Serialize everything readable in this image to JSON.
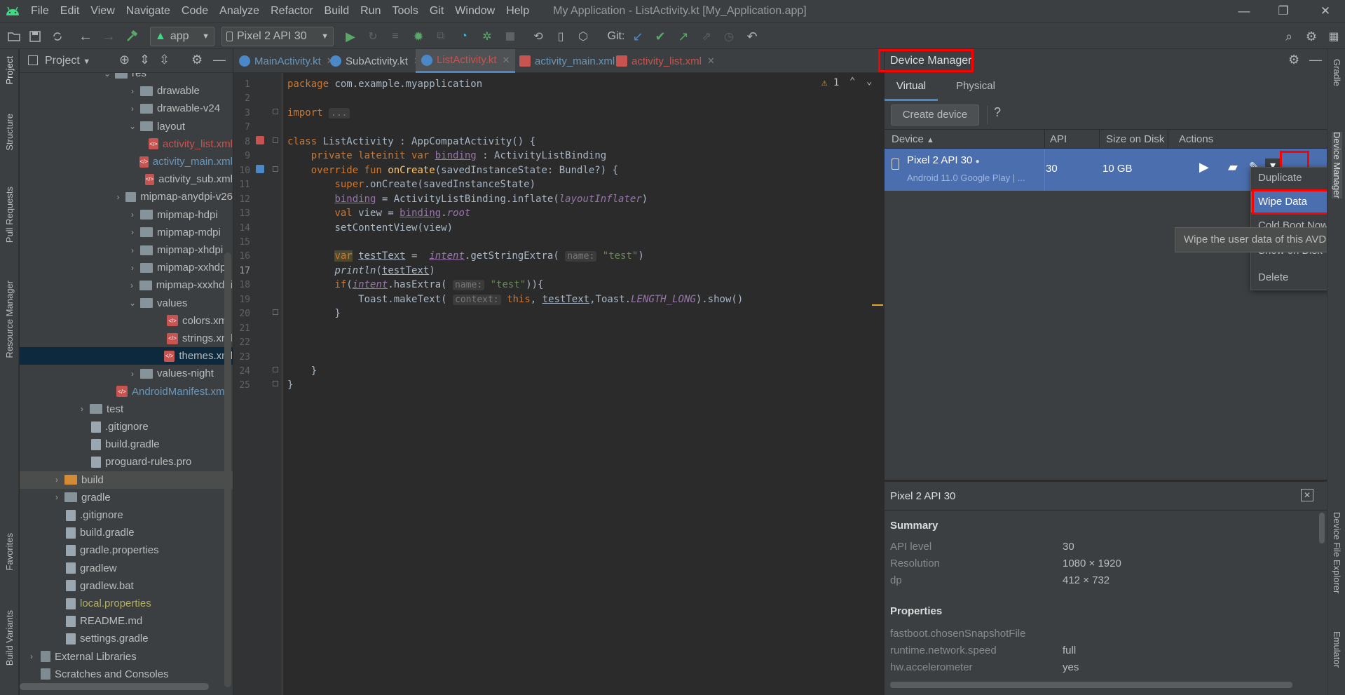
{
  "menu": [
    "File",
    "Edit",
    "View",
    "Navigate",
    "Code",
    "Analyze",
    "Refactor",
    "Build",
    "Run",
    "Tools",
    "Git",
    "Window",
    "Help"
  ],
  "window_title": "My Application - ListActivity.kt [My_Application.app]",
  "toolbar": {
    "config": "app",
    "device": "Pixel 2 API 30",
    "git_label": "Git:"
  },
  "left_strip": [
    "Project",
    "Structure",
    "Pull Requests",
    "Resource Manager",
    "Favorites",
    "Build Variants"
  ],
  "right_strip": [
    "Gradle",
    "Device Manager",
    "Device File Explorer",
    "Emulator"
  ],
  "project": {
    "title": "Project",
    "tree": [
      {
        "label": "res",
        "depth": 3,
        "kind": "folder",
        "arrow": "v"
      },
      {
        "label": "drawable",
        "depth": 4,
        "kind": "folder",
        "arrow": ">"
      },
      {
        "label": "drawable-v24",
        "depth": 4,
        "kind": "folder",
        "arrow": ">"
      },
      {
        "label": "layout",
        "depth": 4,
        "kind": "folder",
        "arrow": "v"
      },
      {
        "label": "activity_list.xml",
        "depth": 5,
        "kind": "xml",
        "color": "#c75450"
      },
      {
        "label": "activity_main.xml",
        "depth": 5,
        "kind": "xml",
        "color": "#6897bb"
      },
      {
        "label": "activity_sub.xml",
        "depth": 5,
        "kind": "xml",
        "color": "#bbbbbb"
      },
      {
        "label": "mipmap-anydpi-v26",
        "depth": 4,
        "kind": "folder",
        "arrow": ">"
      },
      {
        "label": "mipmap-hdpi",
        "depth": 4,
        "kind": "folder",
        "arrow": ">"
      },
      {
        "label": "mipmap-mdpi",
        "depth": 4,
        "kind": "folder",
        "arrow": ">"
      },
      {
        "label": "mipmap-xhdpi",
        "depth": 4,
        "kind": "folder",
        "arrow": ">"
      },
      {
        "label": "mipmap-xxhdpi",
        "depth": 4,
        "kind": "folder",
        "arrow": ">"
      },
      {
        "label": "mipmap-xxxhdpi",
        "depth": 4,
        "kind": "folder",
        "arrow": ">"
      },
      {
        "label": "values",
        "depth": 4,
        "kind": "folder",
        "arrow": "v"
      },
      {
        "label": "colors.xml",
        "depth": 5,
        "kind": "xml",
        "color": "#bbbbbb"
      },
      {
        "label": "strings.xml",
        "depth": 5,
        "kind": "xml",
        "color": "#bbbbbb"
      },
      {
        "label": "themes.xml",
        "depth": 5,
        "kind": "xml",
        "color": "#bbbbbb",
        "selected": true
      },
      {
        "label": "values-night",
        "depth": 4,
        "kind": "folder",
        "arrow": ">"
      },
      {
        "label": "AndroidManifest.xml",
        "depth": 3,
        "kind": "xml",
        "color": "#6897bb"
      },
      {
        "label": "test",
        "depth": 2,
        "kind": "folder",
        "arrow": ">"
      },
      {
        "label": ".gitignore",
        "depth": 2,
        "kind": "file",
        "color": "#bbbbbb"
      },
      {
        "label": "build.gradle",
        "depth": 2,
        "kind": "file",
        "color": "#bbbbbb"
      },
      {
        "label": "proguard-rules.pro",
        "depth": 2,
        "kind": "file",
        "color": "#bbbbbb"
      },
      {
        "label": "build",
        "depth": 1,
        "kind": "folder-orange",
        "arrow": ">",
        "hover": true
      },
      {
        "label": "gradle",
        "depth": 1,
        "kind": "folder",
        "arrow": ">"
      },
      {
        "label": ".gitignore",
        "depth": 1,
        "kind": "file",
        "color": "#bbbbbb"
      },
      {
        "label": "build.gradle",
        "depth": 1,
        "kind": "file",
        "color": "#bbbbbb"
      },
      {
        "label": "gradle.properties",
        "depth": 1,
        "kind": "file",
        "color": "#bbbbbb"
      },
      {
        "label": "gradlew",
        "depth": 1,
        "kind": "file",
        "color": "#bbbbbb"
      },
      {
        "label": "gradlew.bat",
        "depth": 1,
        "kind": "file",
        "color": "#bbbbbb"
      },
      {
        "label": "local.properties",
        "depth": 1,
        "kind": "file",
        "color": "#b3ae60"
      },
      {
        "label": "README.md",
        "depth": 1,
        "kind": "file",
        "color": "#bbbbbb"
      },
      {
        "label": "settings.gradle",
        "depth": 1,
        "kind": "file",
        "color": "#bbbbbb"
      },
      {
        "label": "External Libraries",
        "depth": 0,
        "kind": "lib",
        "arrow": ">"
      },
      {
        "label": "Scratches and Consoles",
        "depth": 0,
        "kind": "lib"
      }
    ]
  },
  "tabs": [
    {
      "label": "MainActivity.kt",
      "color": "#6897bb"
    },
    {
      "label": "SubActivity.kt",
      "color": "#bbbbbb"
    },
    {
      "label": "ListActivity.kt",
      "color": "#c75450",
      "active": true
    },
    {
      "label": "activity_main.xml",
      "color": "#6897bb"
    },
    {
      "label": "activity_list.xml",
      "color": "#c75450"
    }
  ],
  "editor": {
    "warnings": "1",
    "lines": [
      {
        "n": "1",
        "html": "<span class='kw'>package </span><span class='txt'>com.example.myapplication</span>"
      },
      {
        "n": "2",
        "html": ""
      },
      {
        "n": "3",
        "html": "<span class='kw'>import </span><span class='hint'>...</span>"
      },
      {
        "n": "7",
        "html": ""
      },
      {
        "n": "8",
        "html": "<span class='kw'>class </span><span class='txt'>ListActivity : AppCompatActivity() {</span>"
      },
      {
        "n": "9",
        "html": "    <span class='kw'>private lateinit var </span><span class='pr'>binding</span><span class='txt'> : ActivityListBinding</span>"
      },
      {
        "n": "10",
        "html": "    <span class='kw'>override fun </span><span class='fn'>onCreate</span><span class='txt'>(savedInstanceState: Bundle?) {</span>"
      },
      {
        "n": "11",
        "html": "        <span class='kw'>super</span><span class='txt'>.onCreate(savedInstanceState)</span>"
      },
      {
        "n": "12",
        "html": "        <span class='pr'>binding</span><span class='txt'> = ActivityListBinding.inflate(</span><span class='it'>layoutInflater</span><span class='txt'>)</span>"
      },
      {
        "n": "13",
        "html": "        <span class='kw'>val </span><span class='txt'>view = </span><span class='pr'>binding</span><span class='txt'>.</span><span class='it'>root</span>"
      },
      {
        "n": "14",
        "html": "        <span class='txt'>setContentView(view)</span>"
      },
      {
        "n": "15",
        "html": ""
      },
      {
        "n": "16",
        "html": "        <span class='kw' style='background:#4e4a30'>var</span><span class='txt'> </span><span class='txt ul'>testText</span><span class='txt'> =  </span><span class='it ul'>intent</span><span class='txt'>.getStringExtra( </span><span class='hint'>name:</span><span class='str'> \"test\"</span><span class='txt'>)</span>"
      },
      {
        "n": "17",
        "html": "        <span class='it' style='color:#a9b7c6'>println</span><span class='txt'>(</span><span class='txt ul'>testText</span><span class='txt'>)</span>"
      },
      {
        "n": "18",
        "html": "        <span class='kw'>if</span><span class='txt'>(</span><span class='it ul'>intent</span><span class='txt'>.hasExtra( </span><span class='hint'>name:</span><span class='str'> \"test\"</span><span class='txt'>)){</span>"
      },
      {
        "n": "19",
        "html": "            <span class='txt'>Toast.makeText( </span><span class='hint'>context:</span><span class='kw'> this</span><span class='txt'>, </span><span class='txt ul'>testText</span><span class='txt'>,Toast.</span><span class='it'>LENGTH_LONG</span><span class='txt'>).show()</span>"
      },
      {
        "n": "20",
        "html": "        <span class='txt'>}</span>"
      },
      {
        "n": "21",
        "html": ""
      },
      {
        "n": "22",
        "html": ""
      },
      {
        "n": "23",
        "html": ""
      },
      {
        "n": "24",
        "html": "    <span class='txt'>}</span>"
      },
      {
        "n": "25",
        "html": "<span class='txt'>}</span>"
      }
    ]
  },
  "device_manager": {
    "title": "Device Manager",
    "tabs": [
      "Virtual",
      "Physical"
    ],
    "create_button": "Create device",
    "help": "?",
    "columns": {
      "device": "Device",
      "api": "API",
      "size": "Size on Disk",
      "actions": "Actions"
    },
    "row": {
      "name": "Pixel 2 API 30",
      "subtitle": "Android 11.0 Google Play | ...",
      "api": "30",
      "size": "10 GB"
    },
    "context_menu": [
      "Duplicate",
      "Wipe Data",
      "Cold Boot Now",
      "Show on Disk",
      "Delete"
    ],
    "tooltip": "Wipe the user data of this AVD",
    "details": {
      "title": "Pixel 2 API 30",
      "summary_label": "Summary",
      "summary": [
        {
          "k": "API level",
          "v": "30"
        },
        {
          "k": "Resolution",
          "v": "1080 × 1920"
        },
        {
          "k": "dp",
          "v": "412 × 732"
        }
      ],
      "properties_label": "Properties",
      "properties": [
        {
          "k": "fastboot.chosenSnapshotFile",
          "v": ""
        },
        {
          "k": "runtime.network.speed",
          "v": "full"
        },
        {
          "k": "hw.accelerometer",
          "v": "yes"
        }
      ]
    }
  }
}
